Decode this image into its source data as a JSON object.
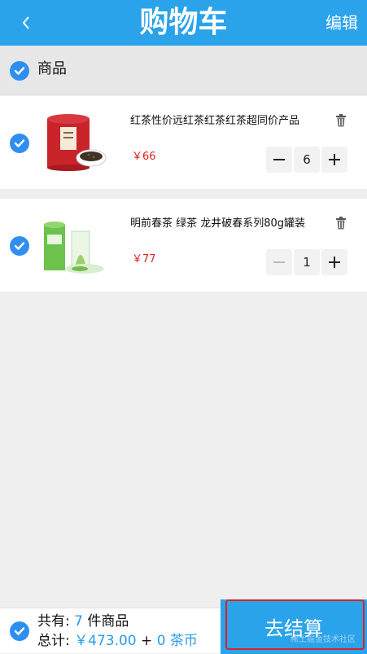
{
  "header": {
    "title": "购物车",
    "edit_label": "编辑",
    "back_icon": "chevron-left-icon"
  },
  "section": {
    "label": "商品"
  },
  "items": [
    {
      "name": "红茶性价远红茶红茶红茶超同价产品",
      "price": "￥66",
      "quantity": "6",
      "image": "red-tea-tin-image"
    },
    {
      "name": "明前春茶 绿茶 龙井破春系列80g罐装",
      "price": "￥77",
      "quantity": "1",
      "image": "green-tea-tin-image"
    }
  ],
  "footer": {
    "count_prefix": "共有: ",
    "count": "7",
    "count_suffix": " 件商品",
    "total_prefix": "总计: ",
    "total": "￥473.00",
    "plus": " + ",
    "coins": "0 茶币",
    "checkout_label": "去结算",
    "watermark": "稀土掘金技术社区"
  },
  "colors": {
    "header": "#2aa3ea",
    "accent": "#2f8ff0",
    "price": "#e02020"
  }
}
